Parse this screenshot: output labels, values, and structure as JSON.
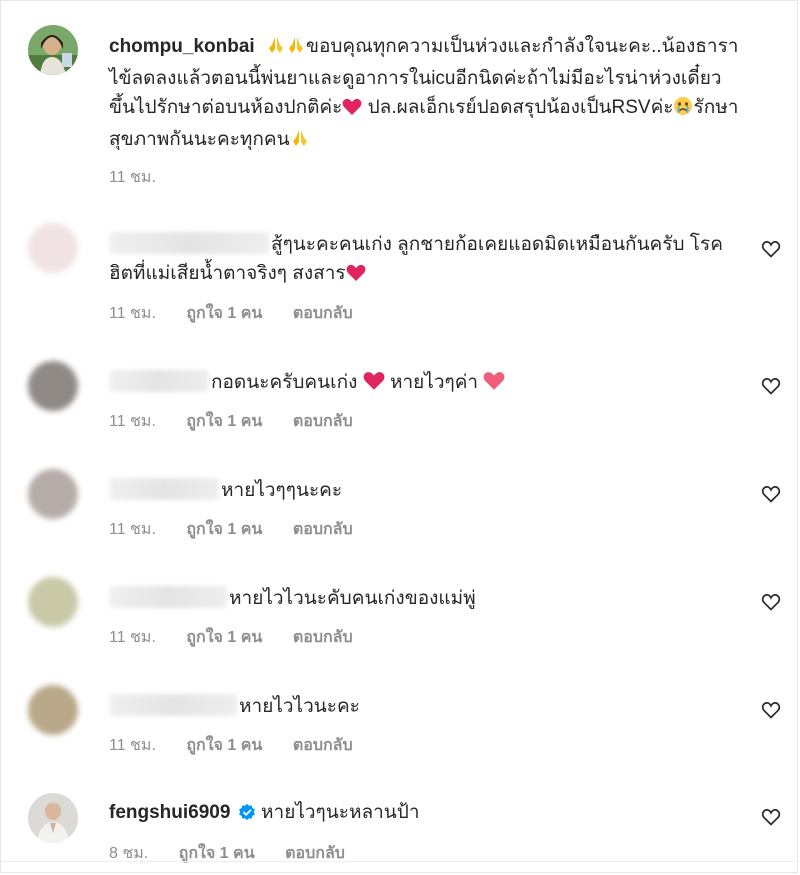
{
  "comments": [
    {
      "username": "chompu_konbai",
      "text": "ขอบคุณทุกความเป็นห่วงและกำลังใจนะคะ..น้องธาราไข้ลดลงแล้วตอนนี้พ่นยาและดูอาการในicuอีกนิดค่ะถ้าไม่มีอะไรน่าห่วงเดี๋ยวขึ้นไปรักษาต่อบนห้องปกติค่ะ",
      "text2": "ปล.ผลเอ็กเรย์ปอดสรุปน้องเป็นRSVค่ะ",
      "text3": "รักษาสุขภาพกันนะคะทุกคน",
      "time": "11 ชม.",
      "verified": false
    },
    {
      "text": "สู้ๆนะคะคนเก่ง ลูกชายก้อเคยแอดมิดเหมือนกันครับ โรคฮิตที่แม่เสียน้ำตาจริงๆ สงสาร",
      "time": "11 ชม.",
      "likes": "ถูกใจ 1 คน",
      "reply": "ตอบกลับ"
    },
    {
      "text": "กอดนะครับคนเก่ง",
      "text2": "หายไวๆค่า",
      "time": "11 ชม.",
      "likes": "ถูกใจ 1 คน",
      "reply": "ตอบกลับ"
    },
    {
      "text": "หายไวๆๆนะคะ",
      "time": "11 ชม.",
      "likes": "ถูกใจ 1 คน",
      "reply": "ตอบกลับ"
    },
    {
      "text": "หายไวไวนะคับคนเก่งของแม่พู่",
      "time": "11 ชม.",
      "likes": "ถูกใจ 1 คน",
      "reply": "ตอบกลับ"
    },
    {
      "text": "หายไวไวนะคะ",
      "time": "11 ชม.",
      "likes": "ถูกใจ 1 คน",
      "reply": "ตอบกลับ"
    },
    {
      "username": "fengshui6909",
      "text": "หายไวๆนะหลานป้า",
      "time": "8 ชม.",
      "likes": "ถูกใจ 1 คน",
      "reply": "ตอบกลับ",
      "verified": true
    }
  ],
  "colors": {
    "text": "#262626",
    "meta": "#8e8e8e",
    "verified": "#0095f6",
    "heart_emoji": "#e0245e"
  }
}
